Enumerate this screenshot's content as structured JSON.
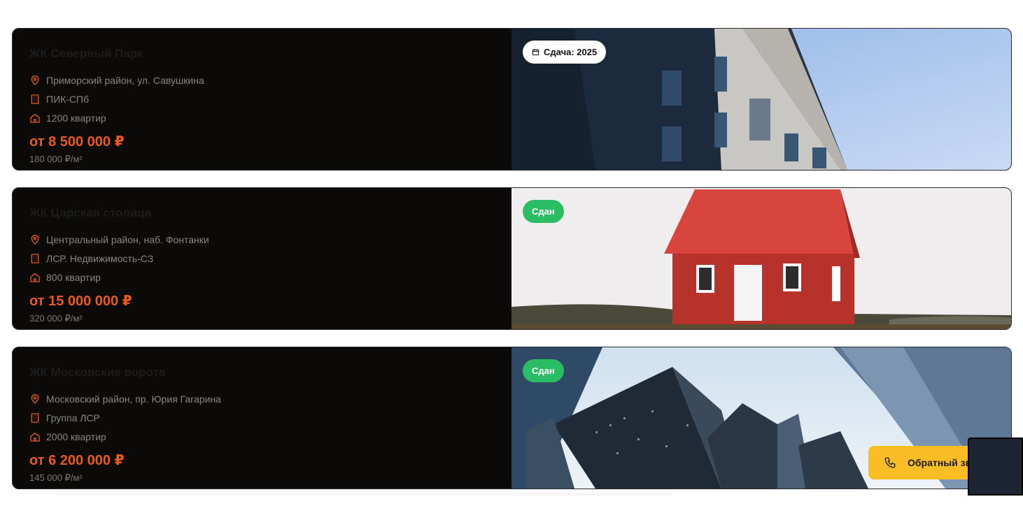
{
  "cards": [
    {
      "name": "ЖК Северный Парк",
      "address": "Приморский район, ул. Савушкина",
      "developer": "ПИК-СПб",
      "flats": "1200 квартир",
      "price": "от 8 500 000 ₽",
      "price_per_m2": "180 000 ₽/м²",
      "badge": "Сдача: 2025",
      "badge_style": "white",
      "photo": "apartment-building-blue-sky"
    },
    {
      "name": "ЖК Царская столица",
      "address": "Центральный район, наб. Фонтанки",
      "developer": "ЛСР. Недвижимость-СЗ",
      "flats": "800 квартир",
      "price": "от 15 000 000 ₽",
      "price_per_m2": "320 000 ₽/м²",
      "badge": "Сдан",
      "badge_style": "green",
      "photo": "red-house-on-hill"
    },
    {
      "name": "ЖК Московские ворота",
      "address": "Московский район, пр. Юрия Гагарина",
      "developer": "Группа ЛСР",
      "flats": "2000 квартир",
      "price": "от 6 200 000 ₽",
      "price_per_m2": "145 000 ₽/м²",
      "badge": "Сдан",
      "badge_style": "green",
      "photo": "glass-skyscrapers-from-below"
    }
  ],
  "callback": {
    "label": "Обратный звонок",
    "icon": "phone-icon"
  },
  "colors": {
    "accent_price": "#ea5a1a",
    "badge_green": "#2bbd63",
    "callback_bg": "#fbbd24",
    "card_bg": "#0b0a09"
  }
}
